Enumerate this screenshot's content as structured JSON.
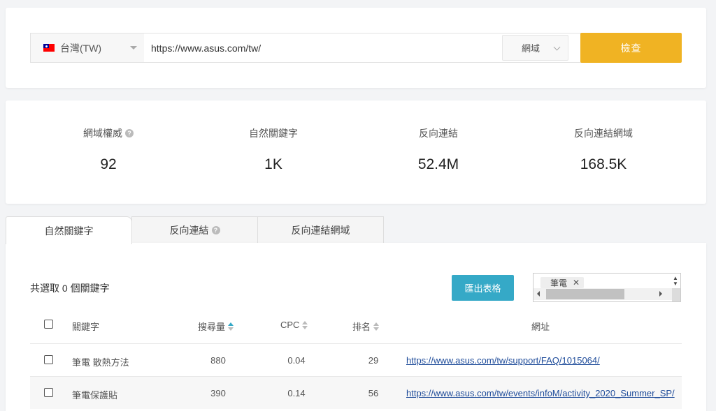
{
  "search": {
    "country_label": "台灣(TW)",
    "url_value": "https://www.asus.com/tw/",
    "scope_label": "網域",
    "check_button_label": "檢查"
  },
  "metrics": [
    {
      "label": "網域權威",
      "value": "92",
      "has_help": true
    },
    {
      "label": "自然關鍵字",
      "value": "1K",
      "has_help": false
    },
    {
      "label": "反向連結",
      "value": "52.4M",
      "has_help": false
    },
    {
      "label": "反向連結網域",
      "value": "168.5K",
      "has_help": false
    }
  ],
  "tabs": [
    {
      "label": "自然關鍵字",
      "active": true
    },
    {
      "label": "反向連結",
      "active": false,
      "has_help": true
    },
    {
      "label": "反向連結網域",
      "active": false
    }
  ],
  "keywords_panel": {
    "selected_count_text": "共選取 0 個關鍵字",
    "export_button_label": "匯出表格",
    "filter_tag": "筆電",
    "columns": [
      "關鍵字",
      "搜尋量",
      "CPC",
      "排名",
      "網址"
    ],
    "rows": [
      {
        "keyword": "筆電 散熱方法",
        "volume": "880",
        "cpc": "0.04",
        "rank": "29",
        "url": "https://www.asus.com/tw/support/FAQ/1015064/"
      },
      {
        "keyword": "筆電保護貼",
        "volume": "390",
        "cpc": "0.14",
        "rank": "56",
        "url": "https://www.asus.com/tw/events/infoM/activity_2020_Summer_SP/"
      }
    ]
  },
  "colors": {
    "check_button": "#f0b323",
    "export_button": "#35a9c7",
    "link": "#1f4c9a",
    "background": "#f3f4f6"
  }
}
